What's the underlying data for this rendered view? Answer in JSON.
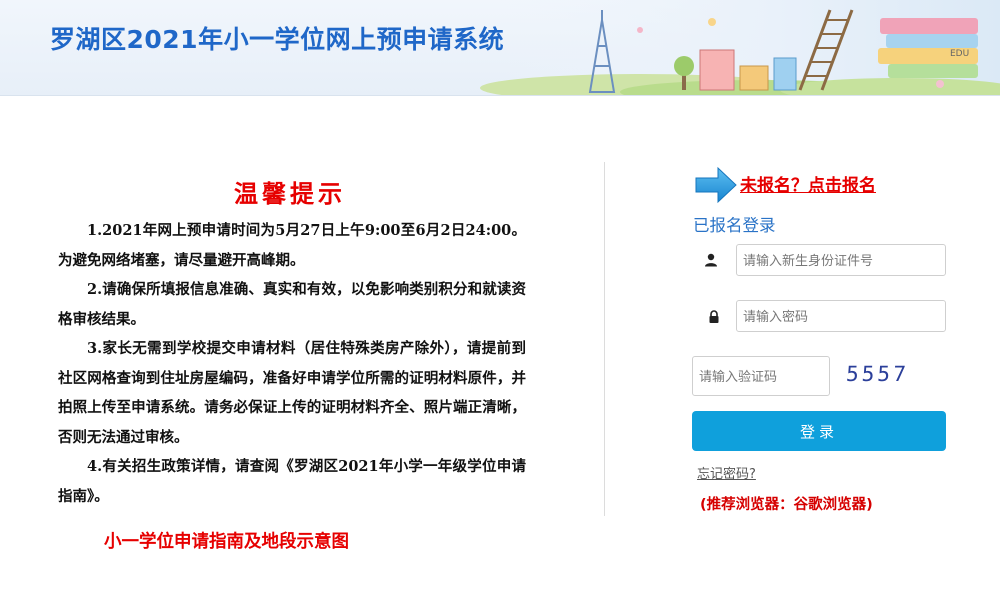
{
  "header": {
    "site_title": "罗湖区2021年小一学位网上预申请系统",
    "tower_sign": "EDU"
  },
  "notice": {
    "title": "温馨提示",
    "paragraphs": [
      "1.2021年网上预申请时间为5月27日上午9:00至6月2日24:00。为避免网络堵塞，请尽量避开高峰期。",
      "2.请确保所填报信息准确、真实和有效，以免影响类别积分和就读资格审核结果。",
      "3.家长无需到学校提交申请材料（居住特殊类房产除外），请提前到社区网格查询到住址房屋编码，准备好申请学位所需的证明材料原件，并拍照上传至申请系统。请务必保证上传的证明材料齐全、照片端正清晰，否则无法通过审核。",
      "4.有关招生政策详情，请查阅《罗湖区2021年小学一年级学位申请指南》。"
    ],
    "guide_link": "小一学位申请指南及地段示意图"
  },
  "login": {
    "register_link": "未报名？点击报名",
    "heading": "已报名登录",
    "id_placeholder": "请输入新生身份证件号",
    "password_placeholder": "请输入密码",
    "captcha_placeholder": "请输入验证码",
    "captcha_text": "5557",
    "button_label": "登录",
    "forgot_link": "忘记密码?",
    "browser_note": "(推荐浏览器：谷歌浏览器)"
  },
  "icons": {
    "arrow": "arrow-right-icon",
    "user": "user-icon",
    "lock": "lock-icon"
  },
  "colors": {
    "title_blue": "#1f67c8",
    "accent_red": "#e60000",
    "button_blue": "#0fa0dc",
    "link_blue": "#2a73c7"
  }
}
